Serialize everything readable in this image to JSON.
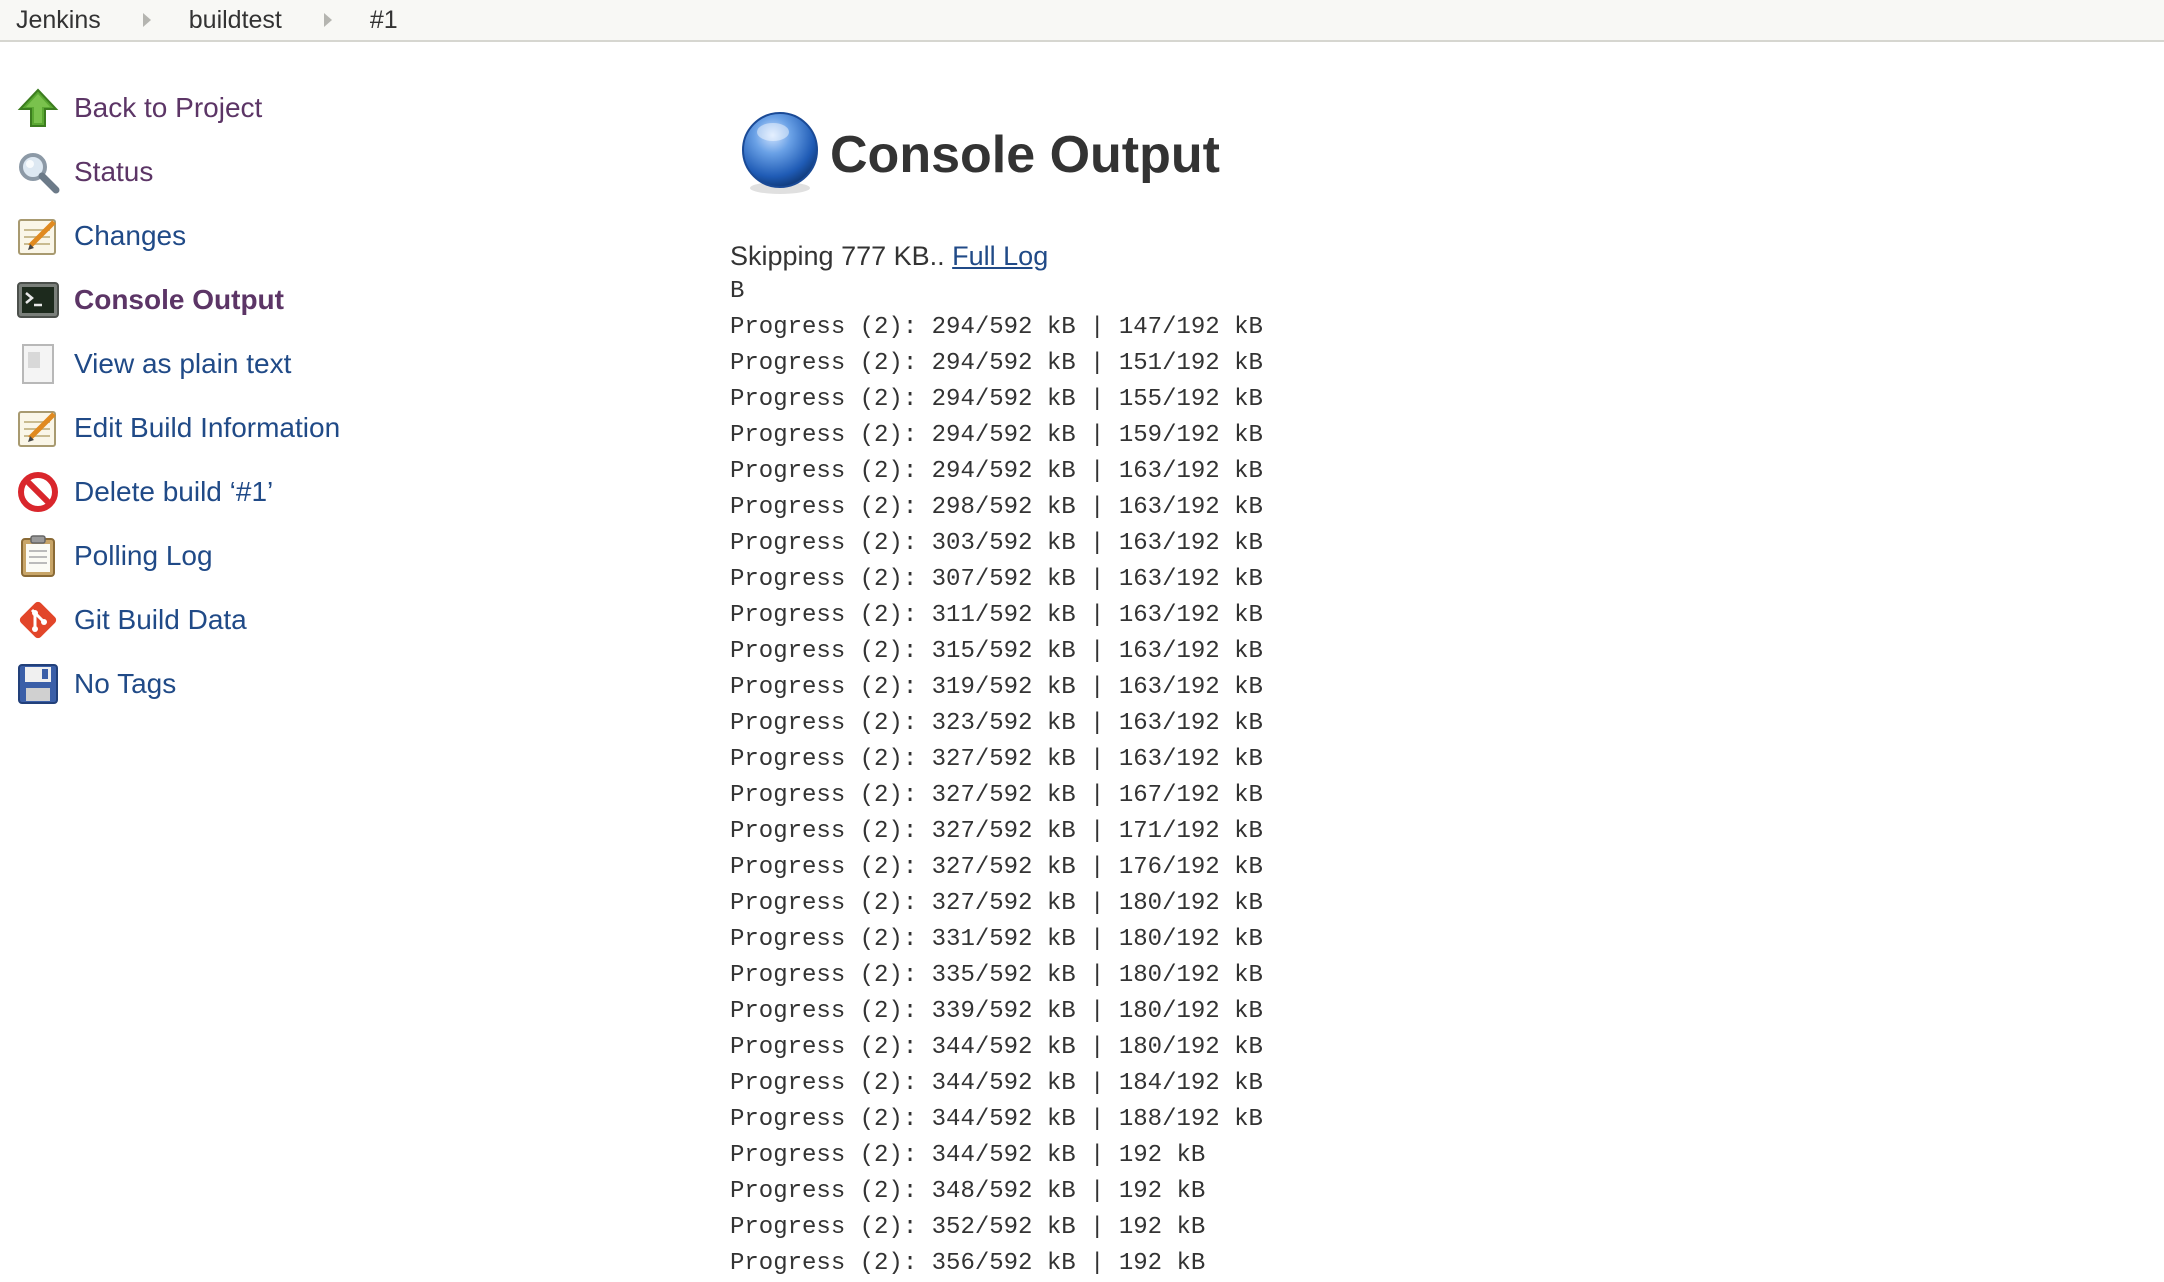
{
  "breadcrumb": {
    "items": [
      "Jenkins",
      "buildtest",
      "#1"
    ]
  },
  "sidebar": {
    "items": [
      {
        "label": "Back to Project",
        "icon": "up-arrow-icon"
      },
      {
        "label": "Status",
        "icon": "magnifier-icon"
      },
      {
        "label": "Changes",
        "icon": "notepad-icon"
      },
      {
        "label": "Console Output",
        "icon": "terminal-icon"
      },
      {
        "label": "View as plain text",
        "icon": "document-icon"
      },
      {
        "label": "Edit Build Information",
        "icon": "notepad-icon"
      },
      {
        "label": "Delete build ‘#1’",
        "icon": "no-entry-icon"
      },
      {
        "label": "Polling Log",
        "icon": "clipboard-icon"
      },
      {
        "label": "Git Build Data",
        "icon": "git-icon"
      },
      {
        "label": "No Tags",
        "icon": "floppy-disk-icon"
      }
    ]
  },
  "main": {
    "title": "Console Output",
    "status_icon": "blue-ball-icon",
    "skip_text": "Skipping 777 KB.. ",
    "full_log_link": "Full Log",
    "console_lines": [
      "B",
      "Progress (2): 294/592 kB | 147/192 kB",
      "Progress (2): 294/592 kB | 151/192 kB",
      "Progress (2): 294/592 kB | 155/192 kB",
      "Progress (2): 294/592 kB | 159/192 kB",
      "Progress (2): 294/592 kB | 163/192 kB",
      "Progress (2): 298/592 kB | 163/192 kB",
      "Progress (2): 303/592 kB | 163/192 kB",
      "Progress (2): 307/592 kB | 163/192 kB",
      "Progress (2): 311/592 kB | 163/192 kB",
      "Progress (2): 315/592 kB | 163/192 kB",
      "Progress (2): 319/592 kB | 163/192 kB",
      "Progress (2): 323/592 kB | 163/192 kB",
      "Progress (2): 327/592 kB | 163/192 kB",
      "Progress (2): 327/592 kB | 167/192 kB",
      "Progress (2): 327/592 kB | 171/192 kB",
      "Progress (2): 327/592 kB | 176/192 kB",
      "Progress (2): 327/592 kB | 180/192 kB",
      "Progress (2): 331/592 kB | 180/192 kB",
      "Progress (2): 335/592 kB | 180/192 kB",
      "Progress (2): 339/592 kB | 180/192 kB",
      "Progress (2): 344/592 kB | 180/192 kB",
      "Progress (2): 344/592 kB | 184/192 kB",
      "Progress (2): 344/592 kB | 188/192 kB",
      "Progress (2): 344/592 kB | 192 kB",
      "Progress (2): 348/592 kB | 192 kB",
      "Progress (2): 352/592 kB | 192 kB",
      "Progress (2): 356/592 kB | 192 kB"
    ]
  },
  "colors": {
    "link": "#204a87",
    "visited": "#5c3566",
    "text": "#333333",
    "breadcrumb_bg": "#f8f8f5"
  }
}
